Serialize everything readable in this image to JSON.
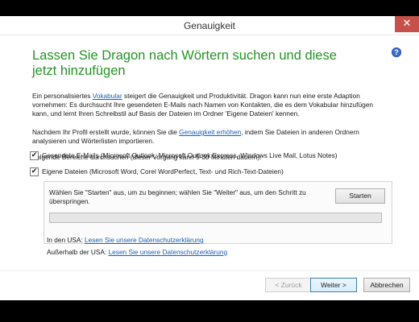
{
  "window": {
    "title": "Genauigkeit",
    "close_glyph": "✕"
  },
  "heading": "Lassen Sie Dragon nach Wörtern suchen und diese jetzt hinzufügen",
  "help_glyph": "?",
  "intro": {
    "part1": "Ein personalisiertes ",
    "link": "Vokabular",
    "part2": " steigert die Genauigkeit und Produktivität. Dragon kann nun eine erste Adaption vornehmen: Es durchsucht Ihre gesendeten E-Mails nach Namen von Kontakten, die es dem Vokabular hinzufügen kann, und lernt Ihren Schreibstil auf Basis der Dateien im Ordner 'Eigene Dateien' kennen."
  },
  "profile": {
    "part1": "Nachdem Ihr Profil erstellt wurde, können Sie die ",
    "link": "Genauigkeit erhöhen",
    "part2": ", indem Sie Dateien in anderen Ordnern analysieren und Wörterlisten importieren."
  },
  "search_label": "Folgende Bereiche durchsuchen (dieser Vorgang kann 5-30 Minuten dauern):",
  "options": [
    {
      "label": "Gesendete E-Mails (Microsoft Outlook, Microsoft Outlook Express, Windows Live Mail, Lotus Notes)",
      "checked": true
    },
    {
      "label": "Eigene Dateien (Microsoft Word, Corel WordPerfect, Text- und Rich-Text-Dateien)",
      "checked": true
    }
  ],
  "check_glyph": "✔",
  "start_panel": {
    "instructions": "Wählen Sie \"Starten\" aus, um zu beginnen; wählen Sie \"Weiter\" aus, um den Schritt zu überspringen.",
    "start_label": "Starten",
    "progress": 0
  },
  "privacy": {
    "usa_prefix": "In den USA: ",
    "usa_link": "Lesen Sie unsere Datenschutzerklärung",
    "outside_prefix": "Außerhalb der USA: ",
    "outside_link": "Lesen Sie unsere Datenschutzerklärung"
  },
  "footer": {
    "back_label": "< Zurück",
    "next_label": "Weiter >",
    "cancel_label": "Abbrechen"
  }
}
